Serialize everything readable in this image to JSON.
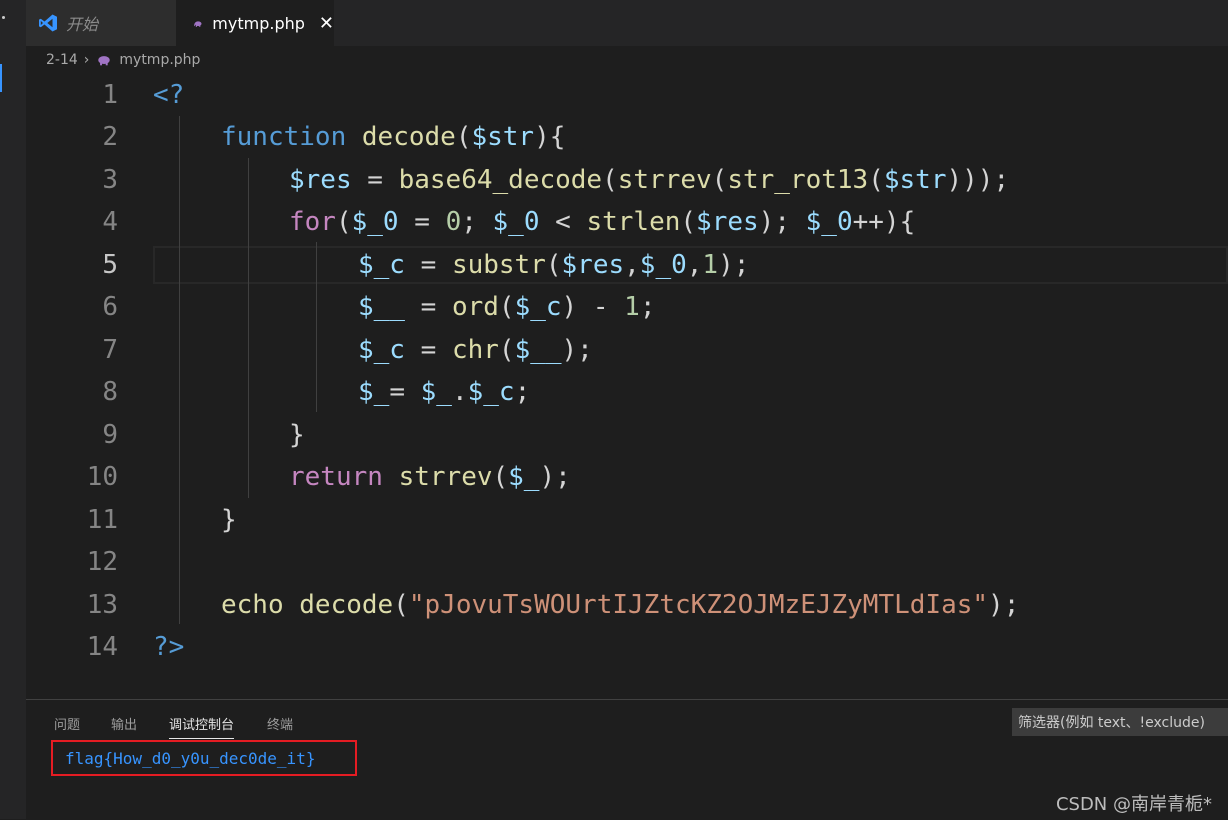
{
  "tabs": [
    {
      "label": "开始",
      "icon": "vscode-icon",
      "active": false
    },
    {
      "label": "mytmp.php",
      "icon": "php-elephant-icon",
      "active": true,
      "close": "✕"
    }
  ],
  "breadcrumb": {
    "folder": "2-14",
    "file": "mytmp.php"
  },
  "editor": {
    "current_line": 5,
    "lines": [
      {
        "n": "1"
      },
      {
        "n": "2"
      },
      {
        "n": "3"
      },
      {
        "n": "4"
      },
      {
        "n": "5"
      },
      {
        "n": "6"
      },
      {
        "n": "7"
      },
      {
        "n": "8"
      },
      {
        "n": "9"
      },
      {
        "n": "10"
      },
      {
        "n": "11"
      },
      {
        "n": "12"
      },
      {
        "n": "13"
      },
      {
        "n": "14"
      }
    ],
    "code": {
      "l1_open": "<?",
      "l2_function": "function",
      "l2_decode": "decode",
      "l2_paren_open": "(",
      "l2_param": "$str",
      "l2_close": "){",
      "l3_res": "$res",
      "l3_eq": " = ",
      "l3_b64": "base64_decode",
      "l3_p1": "(",
      "l3_strrev": "strrev",
      "l3_p2": "(",
      "l3_rot": "str_rot13",
      "l3_p3": "(",
      "l3_str": "$str",
      "l3_end": ")));",
      "l4_for": "for",
      "l4_p": "(",
      "l4_v1": "$_0",
      "l4_eq": " = ",
      "l4_zero": "0",
      "l4_semi1": "; ",
      "l4_v2": "$_0",
      "l4_lt": " < ",
      "l4_strlen": "strlen",
      "l4_p2": "(",
      "l4_res": "$res",
      "l4_semi2": "); ",
      "l4_v3": "$_0",
      "l4_end": "++){",
      "l5_c": "$_c",
      "l5_eq": " = ",
      "l5_substr": "substr",
      "l5_p": "(",
      "l5_res": "$res",
      "l5_comma1": ",",
      "l5_v0": "$_0",
      "l5_comma2": ",",
      "l5_one": "1",
      "l5_end": ");",
      "l6_v": "$__",
      "l6_eq": " = ",
      "l6_ord": "ord",
      "l6_p": "(",
      "l6_c": "$_c",
      "l6_minus": ") - ",
      "l6_one": "1",
      "l6_end": ";",
      "l7_c": "$_c",
      "l7_eq": " = ",
      "l7_chr": "chr",
      "l7_p": "(",
      "l7_v": "$__",
      "l7_end": ");",
      "l8_v": "$_",
      "l8_eq": "= ",
      "l8_v2": "$_",
      "l8_dot": ".",
      "l8_c": "$_c",
      "l8_end": ";",
      "l9_brace": "}",
      "l10_return": "return",
      "l10_sp": " ",
      "l10_strrev": "strrev",
      "l10_p": "(",
      "l10_v": "$_",
      "l10_end": ");",
      "l11_brace": "}",
      "l13_echo": "echo",
      "l13_sp": " ",
      "l13_decode": "decode",
      "l13_p": "(",
      "l13_str": "\"pJovuTsWOUrtIJZtcKZ2OJMzEJZyMTLdIas\"",
      "l13_end": ");",
      "l14_close": "?>"
    }
  },
  "panel": {
    "tabs": [
      "问题",
      "输出",
      "调试控制台",
      "终端"
    ],
    "active_tab": "调试控制台",
    "filter_placeholder": "筛选器(例如 text、!exclude)",
    "output_line": "flag{How_d0_y0u_dec0de_it}"
  },
  "watermark": "CSDN @南岸青栀*",
  "colors": {
    "background": "#1e1e1e",
    "keyword": "#569cd6",
    "control": "#c586c0",
    "function": "#dcdcaa",
    "variable": "#9cdcfe",
    "number": "#b5cea8",
    "string": "#ce9178",
    "highlight_box": "#e51c23",
    "console_text": "#3794ff"
  }
}
